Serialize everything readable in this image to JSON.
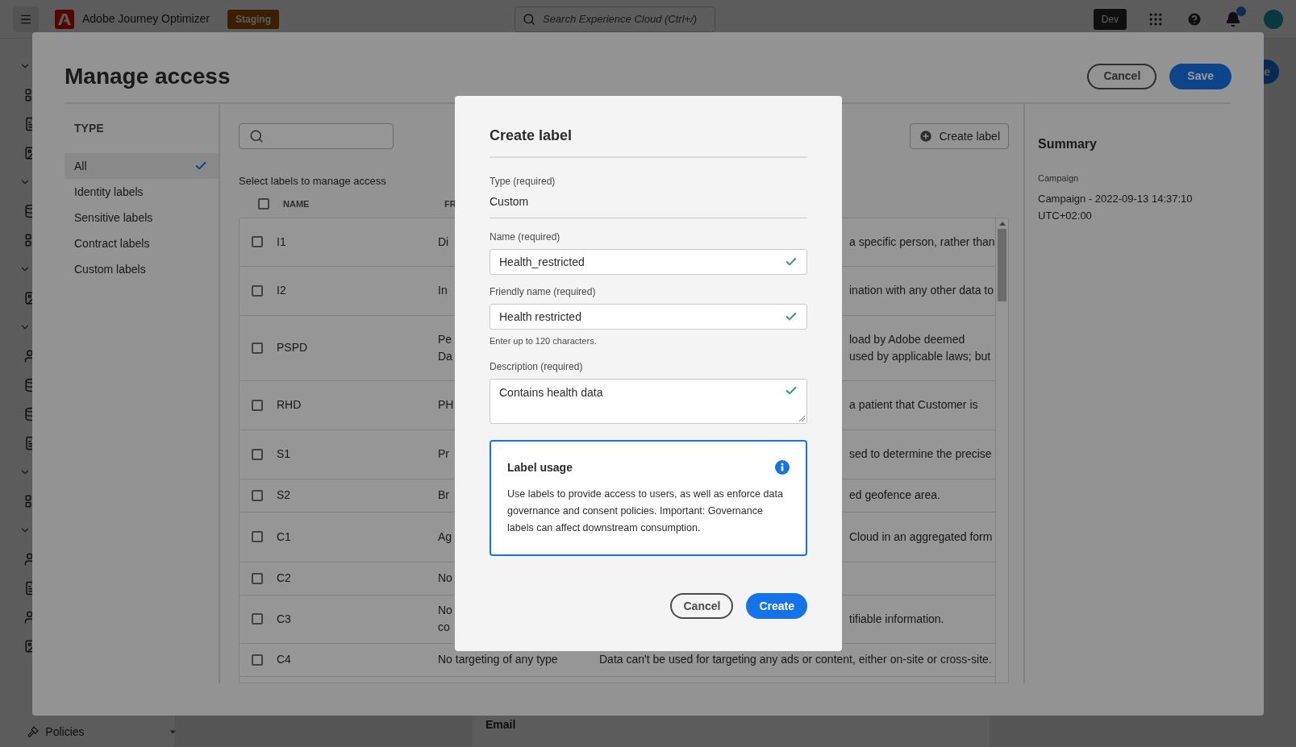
{
  "top_bar": {
    "app_name": "Adobe Journey Optimizer",
    "environment_badge": "Staging",
    "search": {
      "placeholder": "Search Experience Cloud (Ctrl+/)"
    },
    "org_badge": "Dev",
    "notifications": {
      "unread": true
    }
  },
  "background": {
    "nav_item": "Policies",
    "panel_heading": "Email",
    "button_fragment": "e"
  },
  "manage_access": {
    "title": "Manage access",
    "cancel": "Cancel",
    "save": "Save",
    "type_heading": "TYPE",
    "types": [
      {
        "label": "All",
        "selected": true
      },
      {
        "label": "Identity labels",
        "selected": false
      },
      {
        "label": "Sensitive labels",
        "selected": false
      },
      {
        "label": "Contract labels",
        "selected": false
      },
      {
        "label": "Custom labels",
        "selected": false
      }
    ],
    "instruction": "Select labels to manage access",
    "create_label_button": "Create label",
    "table": {
      "select_all_checked": false,
      "columns": [
        "NAME",
        "FR"
      ],
      "rows": [
        {
          "checked": false,
          "name": "I1",
          "column_2": "Di",
          "column_3": "a specific person, rather than"
        },
        {
          "checked": false,
          "name": "I2",
          "column_2": "In",
          "column_3": "ination with any other data to"
        },
        {
          "checked": false,
          "name": "PSPD",
          "column_2": "Pe\nDa",
          "column_3": "load by Adobe deemed\nused by applicable laws; but"
        },
        {
          "checked": false,
          "name": "RHD",
          "column_2": "PH",
          "column_3": "a patient that Customer is"
        },
        {
          "checked": false,
          "name": "S1",
          "column_2": "Pr",
          "column_3": "sed to determine the precise"
        },
        {
          "checked": false,
          "name": "S2",
          "column_2": "Br",
          "column_3": "ed geofence area."
        },
        {
          "checked": false,
          "name": "C1",
          "column_2": "Ag",
          "column_3": "Cloud in an aggregated form"
        },
        {
          "checked": false,
          "name": "C2",
          "column_2": "No"
        },
        {
          "checked": false,
          "name": "C3",
          "column_2": "No\nco",
          "column_3": "tifiable information."
        },
        {
          "checked": false,
          "name": "C4",
          "column_2": "No targeting of any type",
          "column_3": "Data can't be used for targeting any ads or content, either on-site or cross-site."
        }
      ]
    },
    "summary": {
      "title": "Summary",
      "field_label": "Campaign",
      "field_value": "Campaign - 2022-09-13 14:37:10 UTC+02:00"
    }
  },
  "create_label_dialog": {
    "title": "Create label",
    "fields": [
      {
        "kind": "static",
        "label": "Type (required)",
        "value": "Custom"
      },
      {
        "kind": "input",
        "label": "Name (required)",
        "value": "Health_restricted",
        "valid": true
      },
      {
        "kind": "input",
        "label": "Friendly name (required)",
        "value": "Health restricted",
        "valid": true,
        "help": "Enter up to 120 characters."
      },
      {
        "kind": "textarea",
        "label": "Description (required)",
        "value": "Contains health data",
        "valid": true
      }
    ],
    "info_box": {
      "title": "Label usage",
      "text": "Use labels to provide access to users, as well as enforce data governance and consent policies. Important: Governance labels can affect downstream consumption."
    },
    "cancel": "Cancel",
    "create": "Create"
  }
}
